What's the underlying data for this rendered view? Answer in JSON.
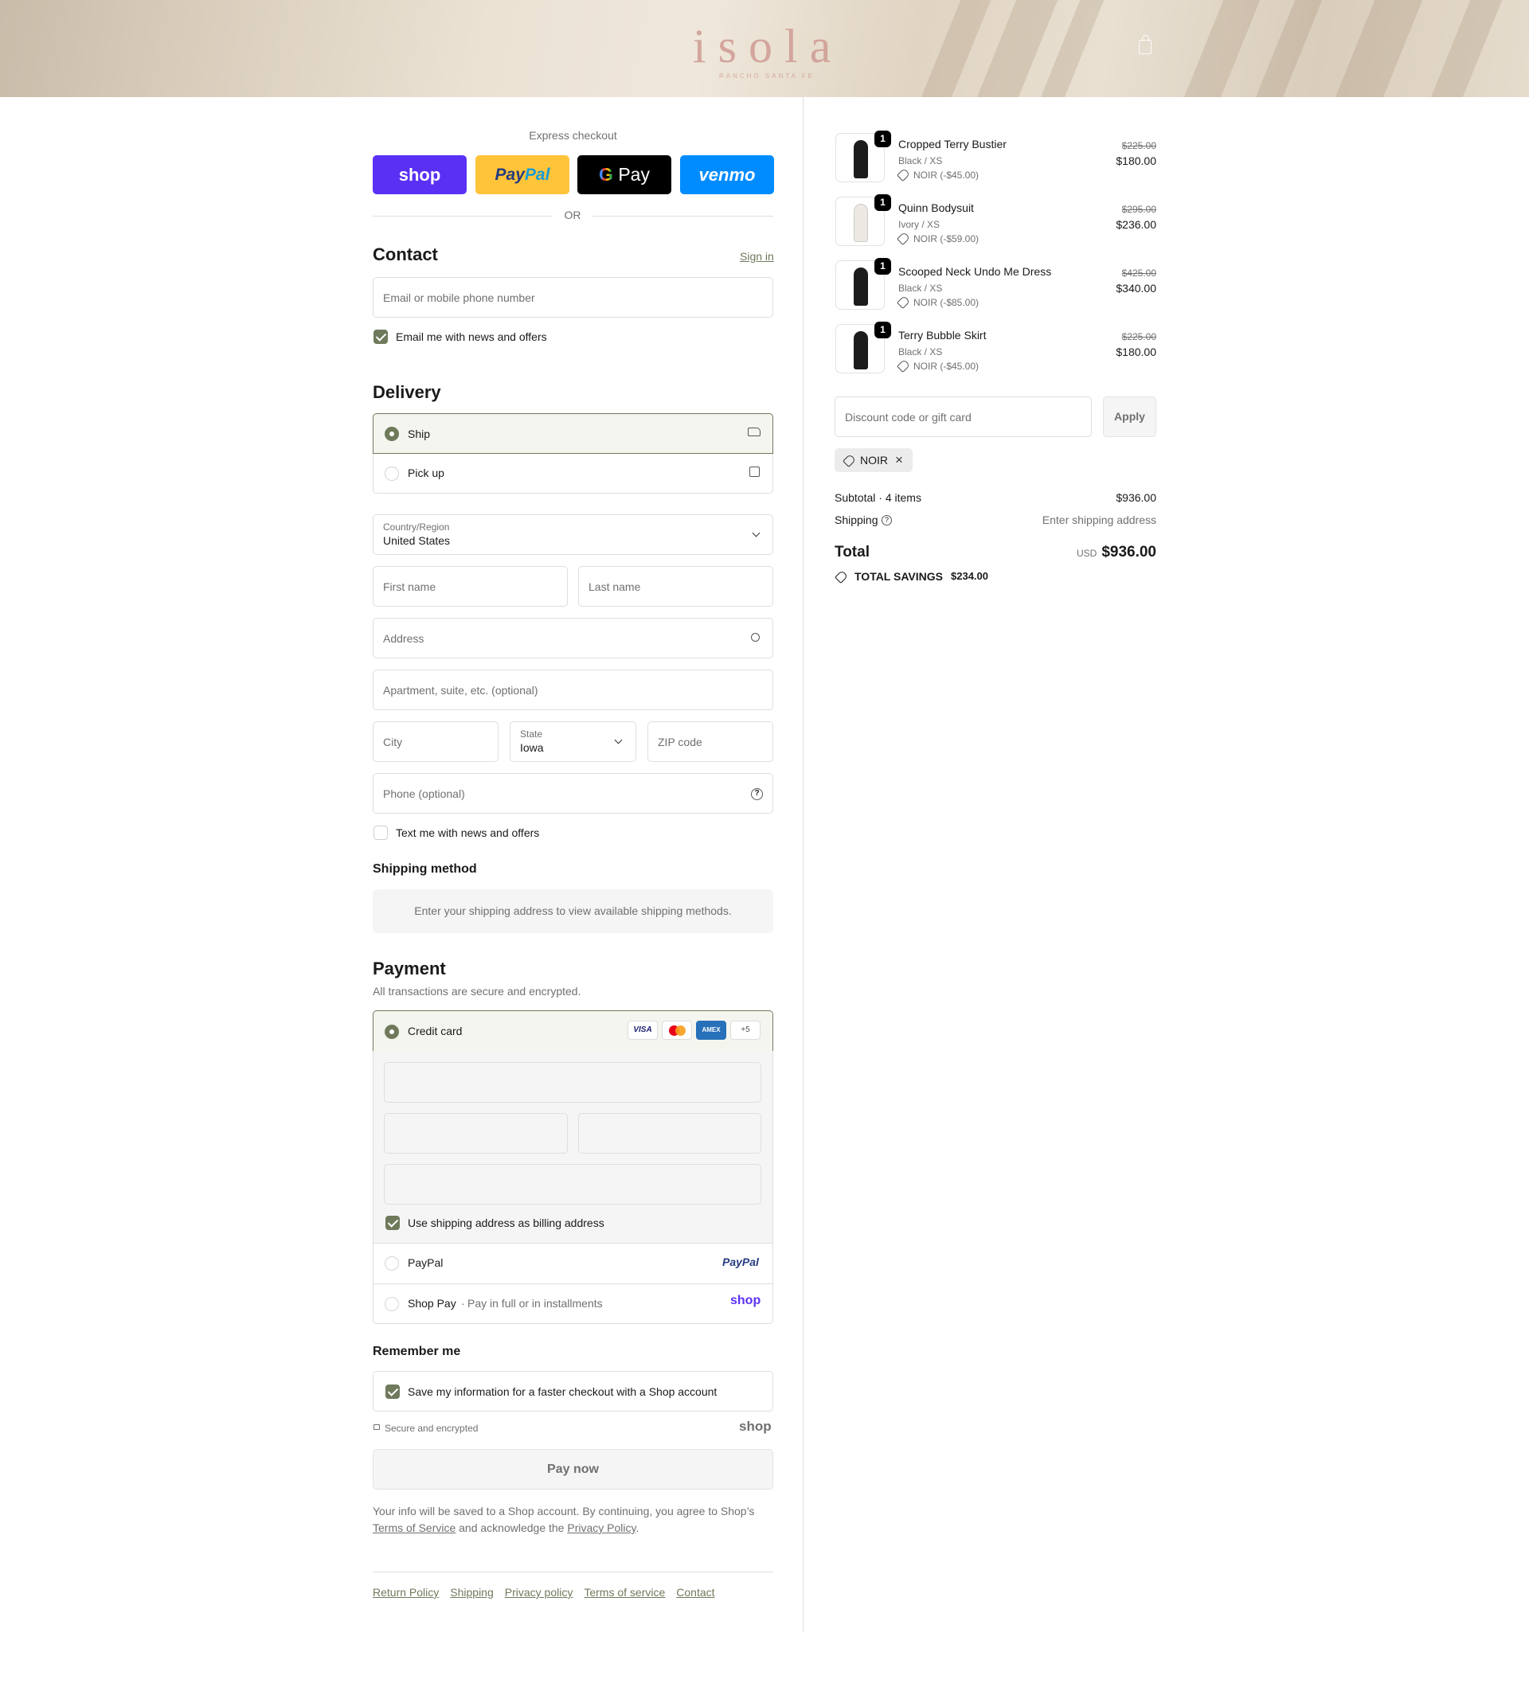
{
  "brand": {
    "logo": "isola",
    "logo_sub": "RANCHO SANTA FE"
  },
  "express": {
    "title": "Express checkout",
    "buttons": [
      {
        "label": "shop",
        "color": "#5a31f4"
      },
      {
        "label": "PayPal",
        "color": "#ffc439"
      },
      {
        "label": "Pay",
        "color": "#000000"
      },
      {
        "label": "venmo",
        "color": "#008cff"
      }
    ],
    "or": "OR"
  },
  "contact": {
    "title": "Contact",
    "sign_in": "Sign in",
    "email_placeholder": "Email or mobile phone number",
    "news_label": "Email me with news and offers",
    "news_checked": true
  },
  "delivery": {
    "title": "Delivery",
    "options": [
      {
        "label": "Ship",
        "selected": true,
        "icon": "truck-icon"
      },
      {
        "label": "Pick up",
        "selected": false,
        "icon": "store-icon"
      }
    ],
    "country_label": "Country/Region",
    "country_value": "United States",
    "first_name_placeholder": "First name",
    "last_name_placeholder": "Last name",
    "address_placeholder": "Address",
    "apartment_placeholder": "Apartment, suite, etc. (optional)",
    "city_placeholder": "City",
    "state_label": "State",
    "state_value": "Iowa",
    "zip_placeholder": "ZIP code",
    "phone_placeholder": "Phone (optional)",
    "text_label": "Text me with news and offers",
    "text_checked": false
  },
  "shipping_method": {
    "title": "Shipping method",
    "notice": "Enter your shipping address to view available shipping methods."
  },
  "payment": {
    "title": "Payment",
    "subtitle": "All transactions are secure and encrypted.",
    "credit_card_label": "Credit card",
    "card_brands": [
      "VISA",
      "MC",
      "AMEX",
      "+5"
    ],
    "billing_label": "Use shipping address as billing address",
    "billing_checked": true,
    "paypal_label": "PayPal",
    "paypal_logo": "PayPal",
    "shoppay_label": "Shop Pay",
    "shoppay_sub": "Pay in full or in installments",
    "shoppay_logo": "shop"
  },
  "remember": {
    "title": "Remember me",
    "save_label": "Save my information for a faster checkout with a Shop account",
    "save_checked": true,
    "secure": "Secure and encrypted",
    "shop_logo": "shop"
  },
  "pay_now": "Pay now",
  "legal": {
    "line1": "Your info will be saved to a Shop account. By continuing, you agree to Shop’s",
    "terms": "Terms of Service",
    "middle": "and acknowledge the",
    "privacy": "Privacy Policy",
    "end": "."
  },
  "footer_links": [
    "Return Policy",
    "Shipping",
    "Privacy policy",
    "Terms of service",
    "Contact"
  ],
  "cart": {
    "items": [
      {
        "name": "Cropped Terry Bustier",
        "variant": "Black / XS",
        "discount": "NOIR (-$45.00)",
        "old_price": "$225.00",
        "price": "$180.00",
        "qty": "1",
        "garment_color": "#1c1c1c"
      },
      {
        "name": "Quinn Bodysuit",
        "variant": "Ivory / XS",
        "discount": "NOIR (-$59.00)",
        "old_price": "$295.00",
        "price": "$236.00",
        "qty": "1",
        "garment_color": "#ece9e3"
      },
      {
        "name": "Scooped Neck Undo Me Dress",
        "variant": "Black / XS",
        "discount": "NOIR (-$85.00)",
        "old_price": "$425.00",
        "price": "$340.00",
        "qty": "1",
        "garment_color": "#1c1c1c"
      },
      {
        "name": "Terry Bubble Skirt",
        "variant": "Black / XS",
        "discount": "NOIR (-$45.00)",
        "old_price": "$225.00",
        "price": "$180.00",
        "qty": "1",
        "garment_color": "#1c1c1c"
      }
    ],
    "discount_placeholder": "Discount code or gift card",
    "apply": "Apply",
    "code": "NOIR",
    "subtotal_label": "Subtotal · 4 items",
    "subtotal_value": "$936.00",
    "shipping_label": "Shipping",
    "shipping_value": "Enter shipping address",
    "total_label": "Total",
    "currency": "USD",
    "total_value": "$936.00",
    "savings_label": "TOTAL SAVINGS",
    "savings_value": "$234.00"
  }
}
